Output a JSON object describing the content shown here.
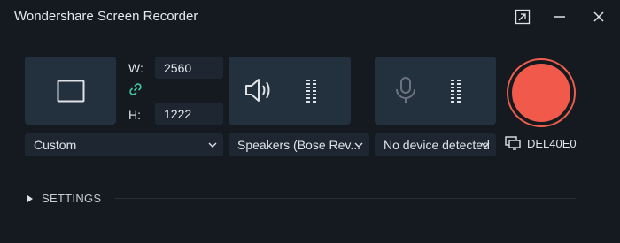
{
  "window": {
    "title": "Wondershare Screen Recorder"
  },
  "titlebar": {
    "restore_icon": "restore-window-icon",
    "minimize_icon": "minimize-icon",
    "close_icon": "close-icon"
  },
  "region": {
    "width_label": "W:",
    "width_value": "2560",
    "height_label": "H:",
    "height_value": "1222",
    "link_icon": "link-chain-icon",
    "preset": "Custom"
  },
  "audio": {
    "speaker_device": "Speakers (Bose Rev...",
    "microphone_device": "No device detected"
  },
  "display": {
    "label": "DEL40E0"
  },
  "settings": {
    "label": "SETTINGS"
  },
  "colors": {
    "background": "#151a20",
    "panel": "#23303d",
    "input": "#1e2731",
    "record": "#f15a4a",
    "link_icon": "#3ec9a7"
  }
}
